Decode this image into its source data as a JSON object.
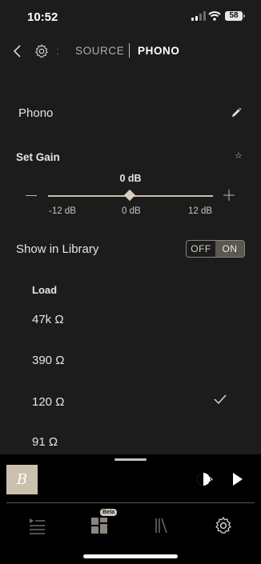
{
  "status": {
    "time": "10:52",
    "battery": "58"
  },
  "header": {
    "source_label": "SOURCE",
    "current_label": "PHONO",
    "dots": ":"
  },
  "input_name": "Phono",
  "gain": {
    "title": "Set Gain",
    "value_label": "0 dB",
    "min_label": "-12 dB",
    "mid_label": "0 dB",
    "max_label": "12 dB",
    "value_db": 0
  },
  "library": {
    "label": "Show in Library",
    "off_label": "OFF",
    "on_label": "ON",
    "state": "ON"
  },
  "load": {
    "title": "Load",
    "items": [
      "47k Ω",
      "390 Ω",
      "120 Ω",
      "91 Ω"
    ],
    "selected": "120 Ω"
  },
  "player": {
    "album_glyph": "B"
  },
  "nav": {
    "beta_label": "Beta"
  },
  "colors": {
    "accent": "#d8cfc2",
    "background": "#1c1c1c"
  }
}
